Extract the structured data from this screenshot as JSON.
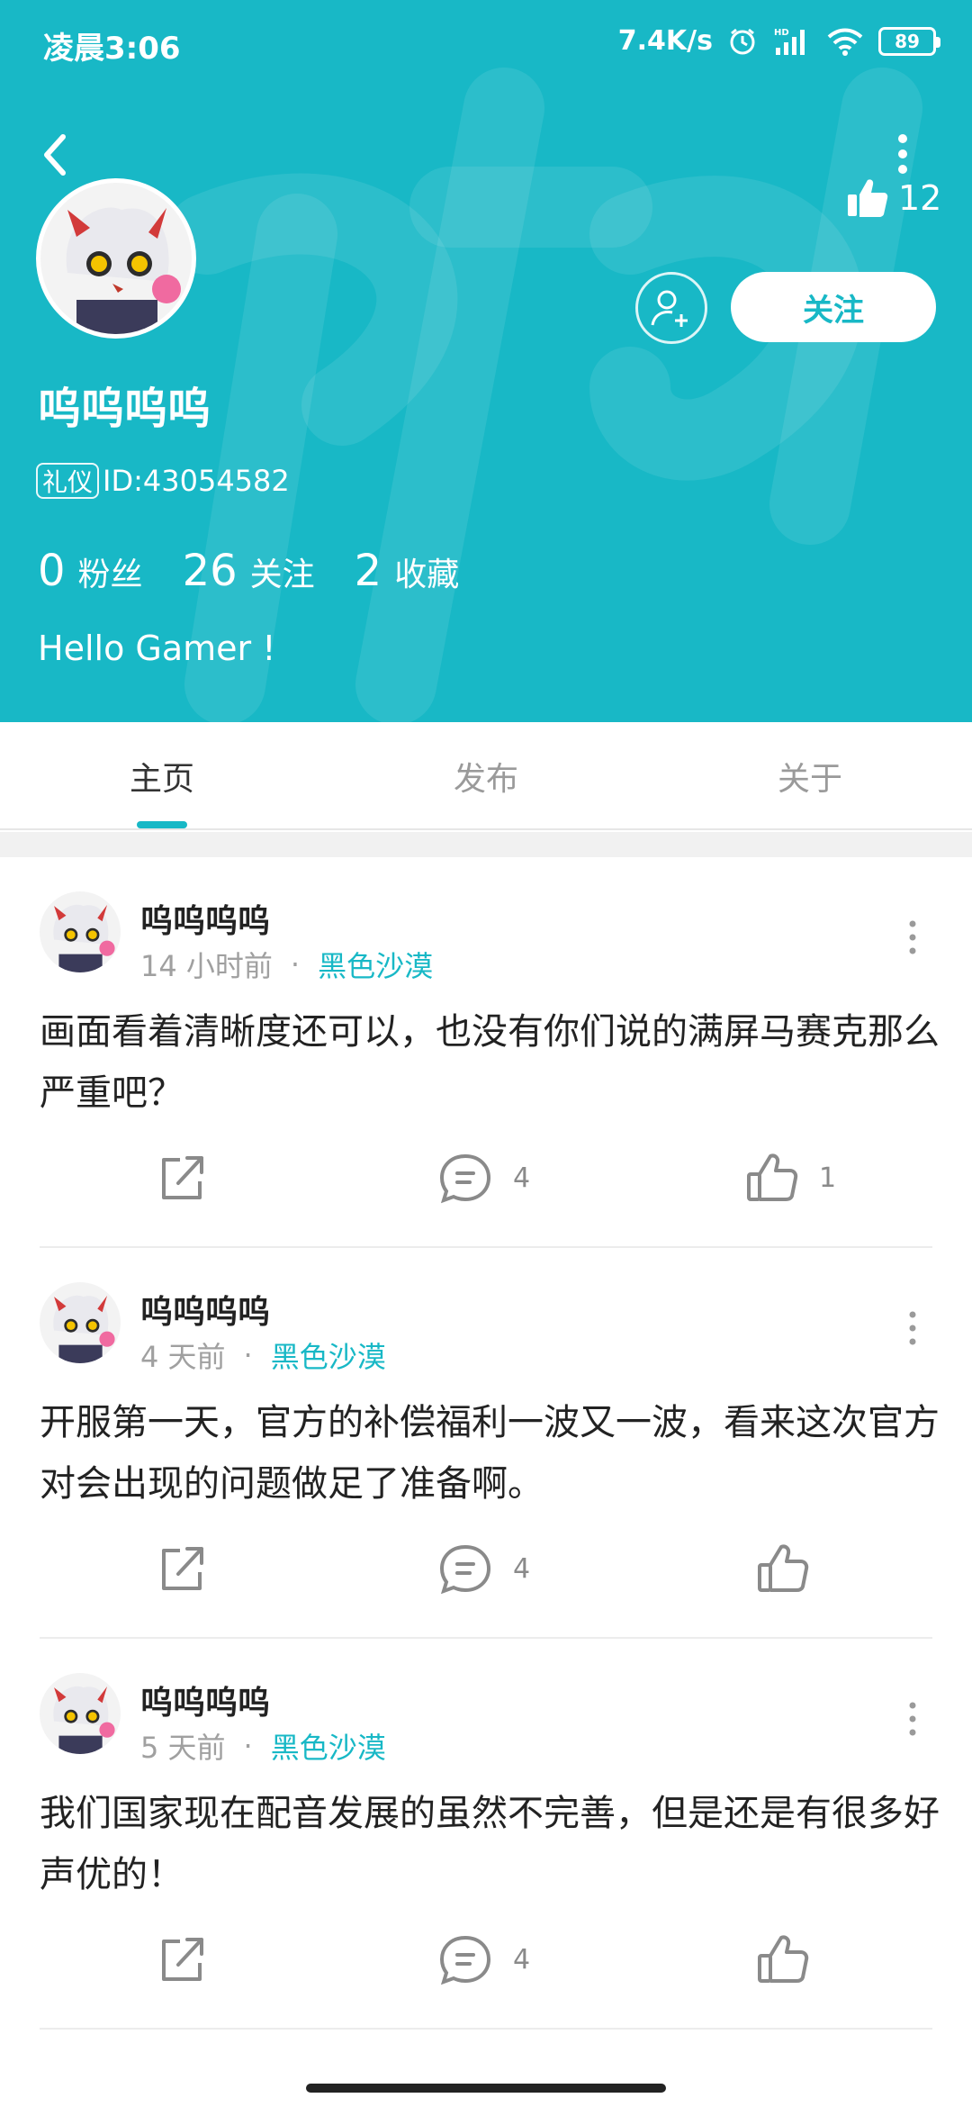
{
  "status_bar": {
    "time": "凌晨3:06",
    "net_speed": "7.4K/s",
    "hd_label": "HD",
    "battery": "89"
  },
  "header": {
    "bg_color": "#18b8c6",
    "likes": "12",
    "follow_label": "关注",
    "username": "呜呜呜呜",
    "tag": "礼仪",
    "id_text": "ID:43054582",
    "stats": [
      {
        "num": "0",
        "label": "粉丝"
      },
      {
        "num": "26",
        "label": "关注"
      },
      {
        "num": "2",
        "label": "收藏"
      }
    ],
    "bio": "Hello Gamer !"
  },
  "tabs": [
    {
      "label": "主页",
      "active": true
    },
    {
      "label": "发布",
      "active": false
    },
    {
      "label": "关于",
      "active": false
    }
  ],
  "posts": [
    {
      "author": "呜呜呜呜",
      "time": "14 小时前",
      "game": "黑色沙漠",
      "text": "画面看着清晰度还可以，也没有你们说的满屏马赛克那么严重吧？",
      "comments": "4",
      "likes": "1"
    },
    {
      "author": "呜呜呜呜",
      "time": "4 天前",
      "game": "黑色沙漠",
      "text": "开服第一天，官方的补偿福利一波又一波，看来这次官方对会出现的问题做足了准备啊。",
      "comments": "4",
      "likes": ""
    },
    {
      "author": "呜呜呜呜",
      "time": "5 天前",
      "game": "黑色沙漠",
      "text": "我们国家现在配音发展的虽然不完善，但是还是有很多好声优的！",
      "comments": "4",
      "likes": ""
    }
  ],
  "icons": [
    "back-icon",
    "more-icon",
    "thumbs-up-icon",
    "add-friend-icon",
    "share-icon",
    "comment-icon",
    "like-icon",
    "alarm-icon",
    "signal-icon",
    "wifi-icon",
    "battery-icon"
  ]
}
